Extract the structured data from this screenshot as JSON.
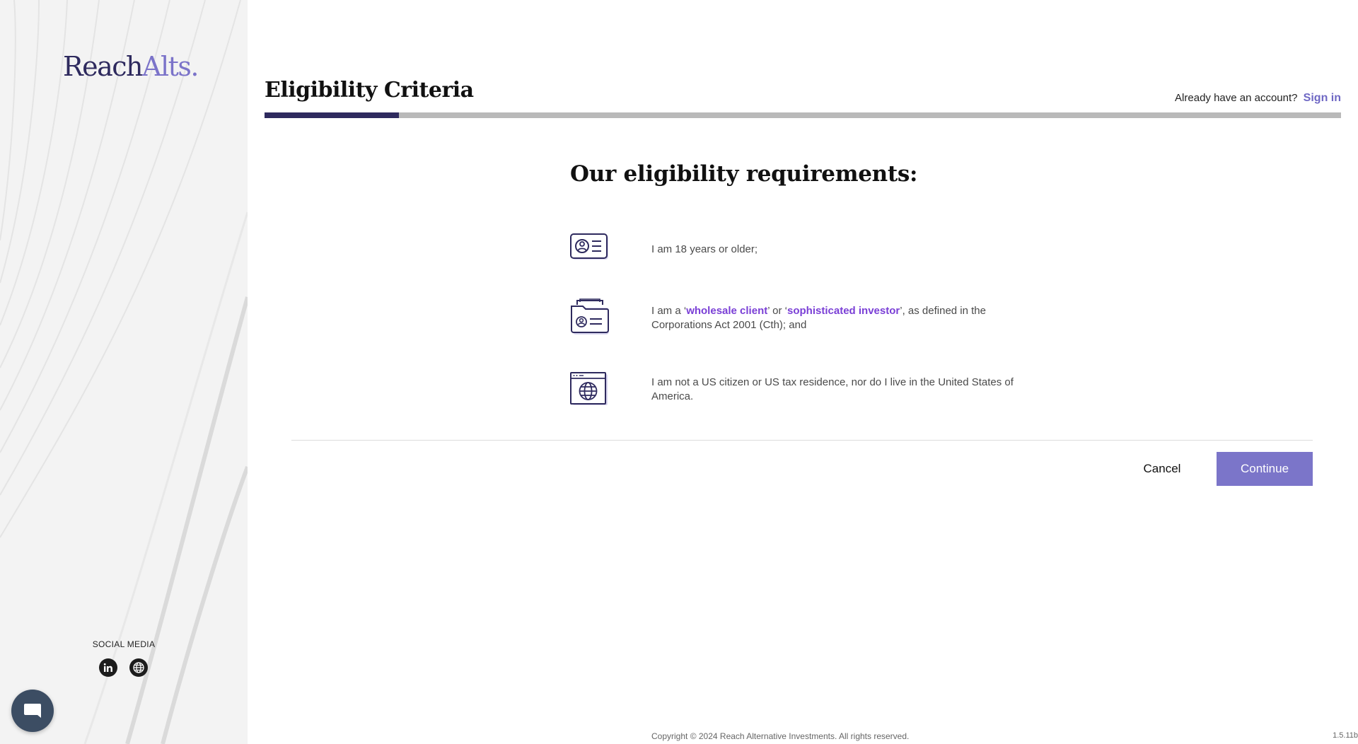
{
  "brand": {
    "logo_part1": "Reach",
    "logo_part2": "Alts."
  },
  "sidebar": {
    "social_title": "SOCIAL MEDIA",
    "social_icons": [
      "linkedin-icon",
      "globe-icon"
    ],
    "chat_icon": "chat-icon"
  },
  "header": {
    "title": "Eligibility Criteria",
    "account_prompt": "Already have an account?",
    "sign_in": "Sign in",
    "progress_fraction": 0.125
  },
  "main": {
    "heading": "Our eligibility requirements:",
    "requirements": [
      {
        "icon": "id-card-icon",
        "text": "I am 18 years or older;"
      },
      {
        "icon": "folder-id-icon",
        "text_pre": "I am a ‘",
        "link1": "wholesale client",
        "text_mid": "’ or ‘",
        "link2": "sophisticated investor",
        "text_post": "’, as defined in the Corporations Act 2001 (Cth); and"
      },
      {
        "icon": "browser-globe-icon",
        "text": "I am not a US citizen or US tax residence, nor do I live in the United States of America."
      }
    ]
  },
  "actions": {
    "cancel": "Cancel",
    "continue": "Continue"
  },
  "footer": {
    "copyright": "Copyright © 2024 Reach Alternative Investments. All rights reserved.",
    "version": "1.5.11b"
  },
  "colors": {
    "brand_dark": "#2e2a5e",
    "brand_accent": "#7b73c9",
    "highlight": "#7a3fd6",
    "continue_button": "#7b75c9"
  }
}
